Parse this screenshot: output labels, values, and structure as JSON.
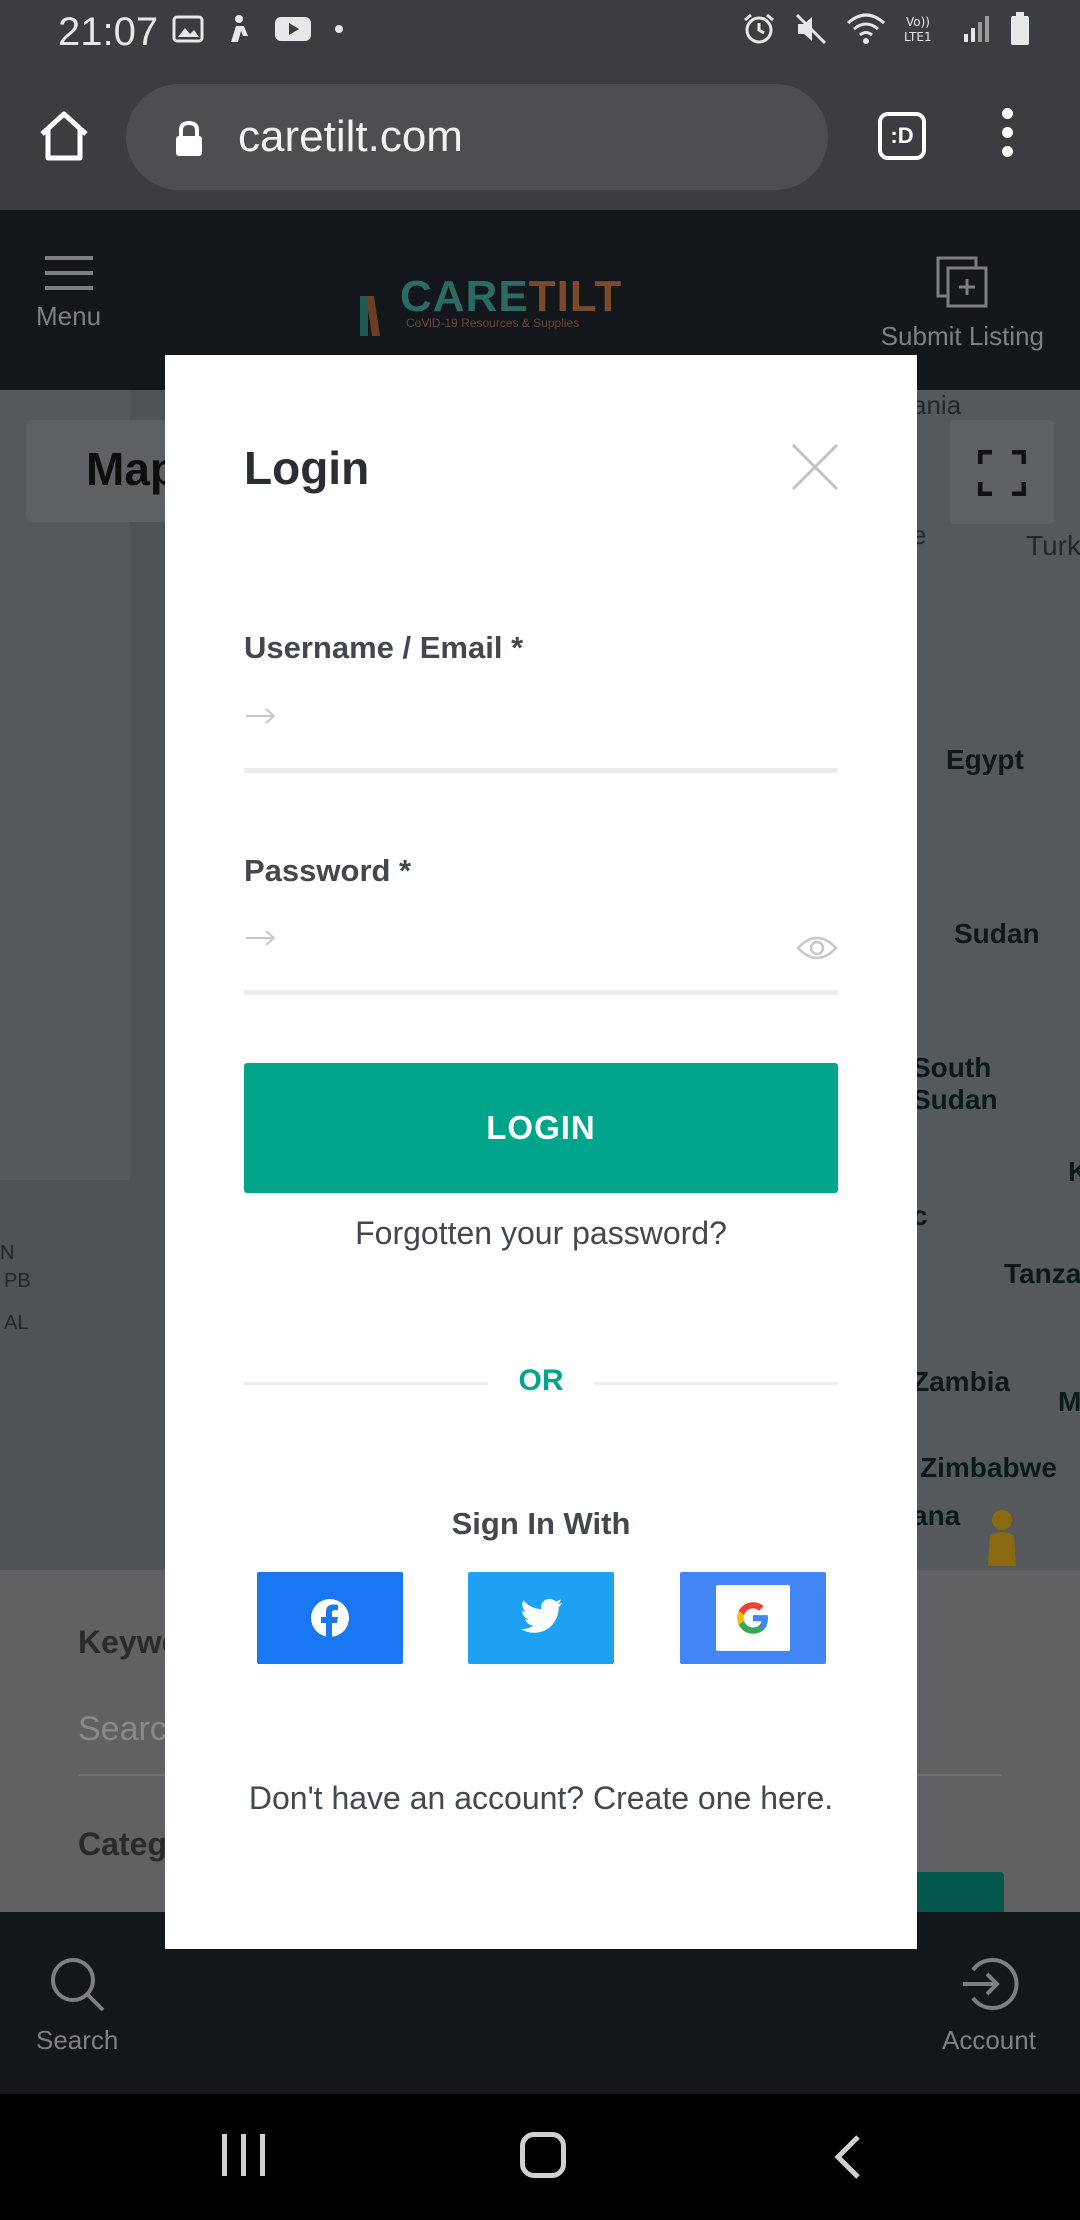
{
  "status_bar": {
    "time": "21:07"
  },
  "browser": {
    "url": "caretilt.com",
    "tab_switcher_label": ":D"
  },
  "site_header": {
    "menu_label": "Menu",
    "logo_word_1": "CARE",
    "logo_word_2": "TILT",
    "logo_tagline": "CoViD-19 Resources & Supplies",
    "submit_label": "Submit Listing"
  },
  "map": {
    "tab_label": "Map",
    "labels": [
      "ania",
      "e",
      "Turk",
      "Egypt",
      "Sudan",
      "South Sudan",
      "K",
      "c",
      "Tanza",
      "Zambia",
      "M",
      "Zimbabwe",
      "ana"
    ],
    "left_labels": [
      "N",
      "PB",
      "AL"
    ]
  },
  "search_panel": {
    "keywords_label": "Keywe",
    "search_placeholder": "Searc",
    "category_label": "Categ"
  },
  "site_nav": {
    "search_label": "Search",
    "account_label": "Account"
  },
  "modal": {
    "title": "Login",
    "username_label": "Username / Email *",
    "password_label": "Password *",
    "login_button": "LOGIN",
    "forgot_link": "Forgotten your password?",
    "or_text": "OR",
    "sign_in_with": "Sign In With",
    "signup_text": "Don't have an account? Create one here."
  },
  "colors": {
    "accent": "#00a58c",
    "facebook": "#1a77f2",
    "twitter": "#1da1f2",
    "google": "#4285f4"
  }
}
